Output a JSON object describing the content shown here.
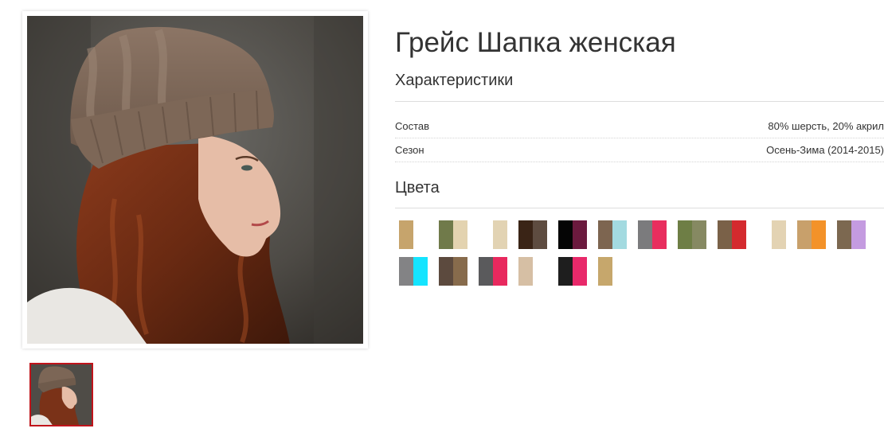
{
  "product": {
    "title": "Грейс Шапка женская",
    "photo_alt": "Женщина в вязаной шапке",
    "thumbnail_alt": "Миниатюра фото"
  },
  "specs": {
    "heading": "Характеристики",
    "rows": [
      {
        "label": "Состав",
        "value": "80% шерсть, 20% акрил"
      },
      {
        "label": "Сезон",
        "value": "Осень-Зима (2014-2015)"
      }
    ]
  },
  "colors": {
    "heading": "Цвета",
    "swatches": [
      [
        "#c6a46c",
        "#ffffff"
      ],
      [
        "#707a4a",
        "#e3d3b0"
      ],
      [
        "#ffffff",
        "#e2d3b3"
      ],
      [
        "#3a2416",
        "#5e4c40"
      ],
      [
        "#050505",
        "#6b1a3e"
      ],
      [
        "#7d6550",
        "#a3dae0"
      ],
      [
        "#7b7b7d",
        "#e82e5e"
      ],
      [
        "#6e7e45",
        "#868962"
      ],
      [
        "#7a6148",
        "#d42a2e"
      ],
      [
        "#ffffff",
        "#e3d3b3"
      ],
      [
        "#c8a06b",
        "#f39229"
      ],
      [
        "#7c6850",
        "#c49be0"
      ],
      [
        "#838385",
        "#14e4ff"
      ],
      [
        "#5c4a3e",
        "#876b4c"
      ],
      [
        "#5a5a5c",
        "#e8295e"
      ],
      [
        "#d6bfa4",
        "#ffffff"
      ],
      [
        "#1e1e1e",
        "#e8296a"
      ],
      [
        "#c6a76c",
        "#ffffff"
      ]
    ]
  }
}
